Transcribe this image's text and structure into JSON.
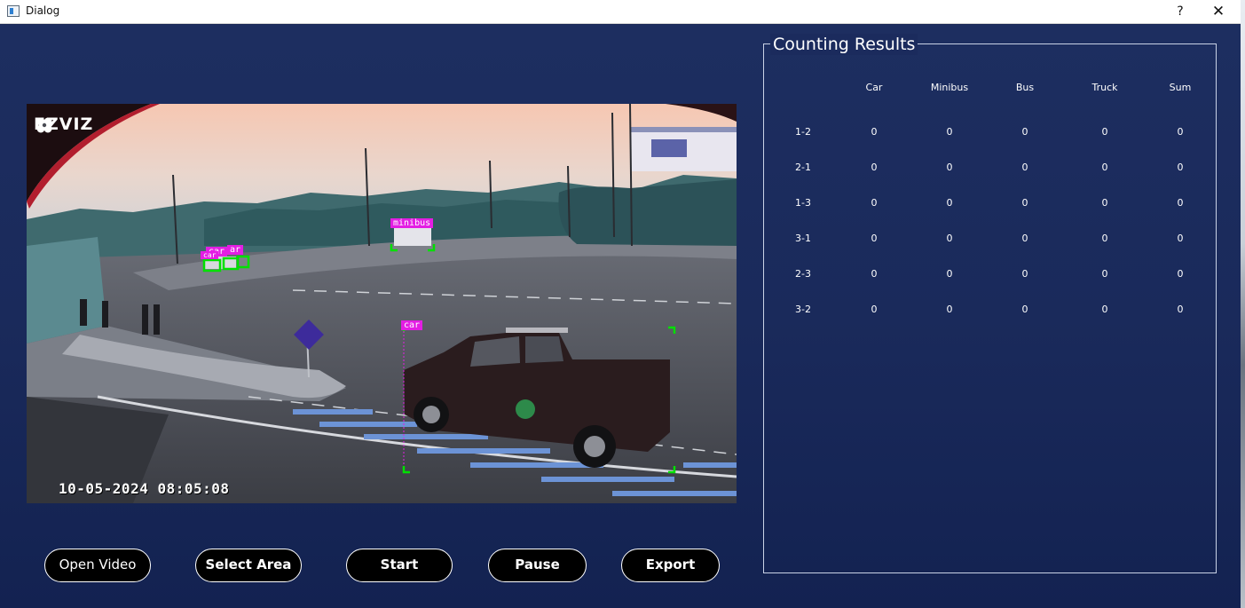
{
  "window": {
    "title": "Dialog",
    "help_label": "?",
    "close_label": "✕"
  },
  "video": {
    "watermark": "EZVIZ",
    "timestamp": "10-05-2024 08:05:08",
    "detections": [
      "minibus",
      "car",
      "car",
      "ar",
      "car"
    ]
  },
  "buttons": {
    "open_video": "Open Video",
    "select_area": "Select Area",
    "start": "Start",
    "pause": "Pause",
    "export": "Export"
  },
  "results": {
    "title": "Counting Results",
    "columns": [
      "Car",
      "Minibus",
      "Bus",
      "Truck",
      "Sum"
    ],
    "rows": [
      {
        "label": "1-2",
        "values": [
          "0",
          "0",
          "0",
          "0",
          "0"
        ]
      },
      {
        "label": "2-1",
        "values": [
          "0",
          "0",
          "0",
          "0",
          "0"
        ]
      },
      {
        "label": "1-3",
        "values": [
          "0",
          "0",
          "0",
          "0",
          "0"
        ]
      },
      {
        "label": "3-1",
        "values": [
          "0",
          "0",
          "0",
          "0",
          "0"
        ]
      },
      {
        "label": "2-3",
        "values": [
          "0",
          "0",
          "0",
          "0",
          "0"
        ]
      },
      {
        "label": "3-2",
        "values": [
          "0",
          "0",
          "0",
          "0",
          "0"
        ]
      }
    ]
  },
  "colors": {
    "background": "#1b2a58",
    "button_fill": "#000000",
    "detection_box": "#00e000",
    "detection_label": "#e31ee3"
  }
}
